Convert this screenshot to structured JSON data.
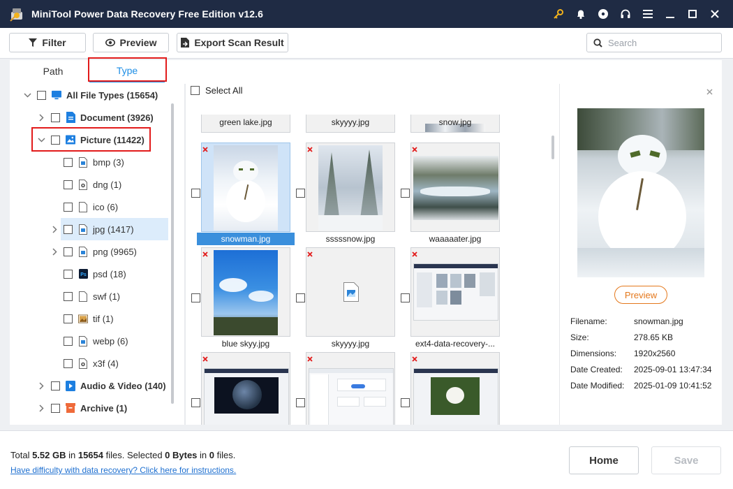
{
  "window": {
    "title": "MiniTool Power Data Recovery Free Edition v12.6"
  },
  "titlebar_icons": [
    "key-icon",
    "bell-icon",
    "disc-icon",
    "headset-icon",
    "menu-icon",
    "minimize-icon",
    "maximize-icon",
    "close-icon"
  ],
  "toolbar": {
    "filter_label": "Filter",
    "preview_label": "Preview",
    "export_label": "Export Scan Result",
    "search_placeholder": "Search"
  },
  "tabs": {
    "path": "Path",
    "type": "Type",
    "active": "Type"
  },
  "tree": {
    "root": "All File Types (15654)",
    "items": [
      {
        "label": "Document (3926)"
      },
      {
        "label": "Picture (11422)"
      },
      {
        "label": "bmp (3)"
      },
      {
        "label": "dng (1)"
      },
      {
        "label": "ico (6)"
      },
      {
        "label": "jpg (1417)"
      },
      {
        "label": "png (9965)"
      },
      {
        "label": "psd (18)"
      },
      {
        "label": "swf (1)"
      },
      {
        "label": "tif (1)"
      },
      {
        "label": "webp (6)"
      },
      {
        "label": "x3f (4)"
      },
      {
        "label": "Audio & Video (140)"
      },
      {
        "label": "Archive (1)"
      }
    ]
  },
  "grid": {
    "select_all": "Select All",
    "files": [
      {
        "name": "green lake.jpg"
      },
      {
        "name": "skyyyy.jpg"
      },
      {
        "name": "snow.jpg"
      },
      {
        "name": "snowman.jpg",
        "selected": true
      },
      {
        "name": "sssssnow.jpg"
      },
      {
        "name": "waaaaater.jpg"
      },
      {
        "name": "blue skyy.jpg"
      },
      {
        "name": "skyyyy.jpg"
      },
      {
        "name": "ext4-data-recovery-..."
      },
      {
        "name": ""
      },
      {
        "name": ""
      },
      {
        "name": ""
      }
    ]
  },
  "details": {
    "preview_button": "Preview",
    "rows": [
      {
        "key": "Filename:",
        "value": "snowman.jpg"
      },
      {
        "key": "Size:",
        "value": "278.65 KB"
      },
      {
        "key": "Dimensions:",
        "value": "1920x2560"
      },
      {
        "key": "Date Created:",
        "value": "2025-09-01 13:47:34"
      },
      {
        "key": "Date Modified:",
        "value": "2025-01-09 10:41:52"
      }
    ]
  },
  "footer": {
    "total_prefix": "Total ",
    "total_size": "5.52 GB",
    "in1": " in ",
    "total_count": "15654",
    "files1": " files.  Selected ",
    "selected_size": "0 Bytes",
    "in2": " in ",
    "selected_count": "0",
    "files2": " files.",
    "help_link": "Have difficulty with data recovery? Click here for instructions.",
    "home_label": "Home",
    "save_label": "Save"
  },
  "colors": {
    "titlebar": "#1f2b44",
    "accent_blue": "#1d8ee6",
    "highlight_red": "#e21b1b",
    "preview_orange": "#e4781c"
  }
}
